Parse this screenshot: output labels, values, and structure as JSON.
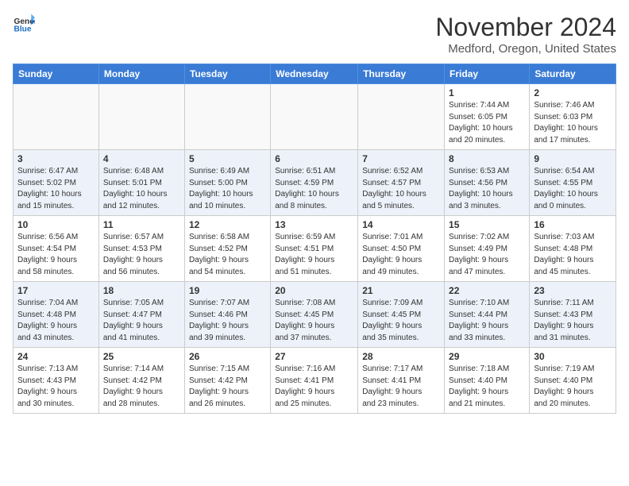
{
  "header": {
    "logo_line1": "General",
    "logo_line2": "Blue",
    "month": "November 2024",
    "location": "Medford, Oregon, United States"
  },
  "weekdays": [
    "Sunday",
    "Monday",
    "Tuesday",
    "Wednesday",
    "Thursday",
    "Friday",
    "Saturday"
  ],
  "weeks": [
    [
      {
        "day": "",
        "info": ""
      },
      {
        "day": "",
        "info": ""
      },
      {
        "day": "",
        "info": ""
      },
      {
        "day": "",
        "info": ""
      },
      {
        "day": "",
        "info": ""
      },
      {
        "day": "1",
        "info": "Sunrise: 7:44 AM\nSunset: 6:05 PM\nDaylight: 10 hours\nand 20 minutes."
      },
      {
        "day": "2",
        "info": "Sunrise: 7:46 AM\nSunset: 6:03 PM\nDaylight: 10 hours\nand 17 minutes."
      }
    ],
    [
      {
        "day": "3",
        "info": "Sunrise: 6:47 AM\nSunset: 5:02 PM\nDaylight: 10 hours\nand 15 minutes."
      },
      {
        "day": "4",
        "info": "Sunrise: 6:48 AM\nSunset: 5:01 PM\nDaylight: 10 hours\nand 12 minutes."
      },
      {
        "day": "5",
        "info": "Sunrise: 6:49 AM\nSunset: 5:00 PM\nDaylight: 10 hours\nand 10 minutes."
      },
      {
        "day": "6",
        "info": "Sunrise: 6:51 AM\nSunset: 4:59 PM\nDaylight: 10 hours\nand 8 minutes."
      },
      {
        "day": "7",
        "info": "Sunrise: 6:52 AM\nSunset: 4:57 PM\nDaylight: 10 hours\nand 5 minutes."
      },
      {
        "day": "8",
        "info": "Sunrise: 6:53 AM\nSunset: 4:56 PM\nDaylight: 10 hours\nand 3 minutes."
      },
      {
        "day": "9",
        "info": "Sunrise: 6:54 AM\nSunset: 4:55 PM\nDaylight: 10 hours\nand 0 minutes."
      }
    ],
    [
      {
        "day": "10",
        "info": "Sunrise: 6:56 AM\nSunset: 4:54 PM\nDaylight: 9 hours\nand 58 minutes."
      },
      {
        "day": "11",
        "info": "Sunrise: 6:57 AM\nSunset: 4:53 PM\nDaylight: 9 hours\nand 56 minutes."
      },
      {
        "day": "12",
        "info": "Sunrise: 6:58 AM\nSunset: 4:52 PM\nDaylight: 9 hours\nand 54 minutes."
      },
      {
        "day": "13",
        "info": "Sunrise: 6:59 AM\nSunset: 4:51 PM\nDaylight: 9 hours\nand 51 minutes."
      },
      {
        "day": "14",
        "info": "Sunrise: 7:01 AM\nSunset: 4:50 PM\nDaylight: 9 hours\nand 49 minutes."
      },
      {
        "day": "15",
        "info": "Sunrise: 7:02 AM\nSunset: 4:49 PM\nDaylight: 9 hours\nand 47 minutes."
      },
      {
        "day": "16",
        "info": "Sunrise: 7:03 AM\nSunset: 4:48 PM\nDaylight: 9 hours\nand 45 minutes."
      }
    ],
    [
      {
        "day": "17",
        "info": "Sunrise: 7:04 AM\nSunset: 4:48 PM\nDaylight: 9 hours\nand 43 minutes."
      },
      {
        "day": "18",
        "info": "Sunrise: 7:05 AM\nSunset: 4:47 PM\nDaylight: 9 hours\nand 41 minutes."
      },
      {
        "day": "19",
        "info": "Sunrise: 7:07 AM\nSunset: 4:46 PM\nDaylight: 9 hours\nand 39 minutes."
      },
      {
        "day": "20",
        "info": "Sunrise: 7:08 AM\nSunset: 4:45 PM\nDaylight: 9 hours\nand 37 minutes."
      },
      {
        "day": "21",
        "info": "Sunrise: 7:09 AM\nSunset: 4:45 PM\nDaylight: 9 hours\nand 35 minutes."
      },
      {
        "day": "22",
        "info": "Sunrise: 7:10 AM\nSunset: 4:44 PM\nDaylight: 9 hours\nand 33 minutes."
      },
      {
        "day": "23",
        "info": "Sunrise: 7:11 AM\nSunset: 4:43 PM\nDaylight: 9 hours\nand 31 minutes."
      }
    ],
    [
      {
        "day": "24",
        "info": "Sunrise: 7:13 AM\nSunset: 4:43 PM\nDaylight: 9 hours\nand 30 minutes."
      },
      {
        "day": "25",
        "info": "Sunrise: 7:14 AM\nSunset: 4:42 PM\nDaylight: 9 hours\nand 28 minutes."
      },
      {
        "day": "26",
        "info": "Sunrise: 7:15 AM\nSunset: 4:42 PM\nDaylight: 9 hours\nand 26 minutes."
      },
      {
        "day": "27",
        "info": "Sunrise: 7:16 AM\nSunset: 4:41 PM\nDaylight: 9 hours\nand 25 minutes."
      },
      {
        "day": "28",
        "info": "Sunrise: 7:17 AM\nSunset: 4:41 PM\nDaylight: 9 hours\nand 23 minutes."
      },
      {
        "day": "29",
        "info": "Sunrise: 7:18 AM\nSunset: 4:40 PM\nDaylight: 9 hours\nand 21 minutes."
      },
      {
        "day": "30",
        "info": "Sunrise: 7:19 AM\nSunset: 4:40 PM\nDaylight: 9 hours\nand 20 minutes."
      }
    ]
  ]
}
